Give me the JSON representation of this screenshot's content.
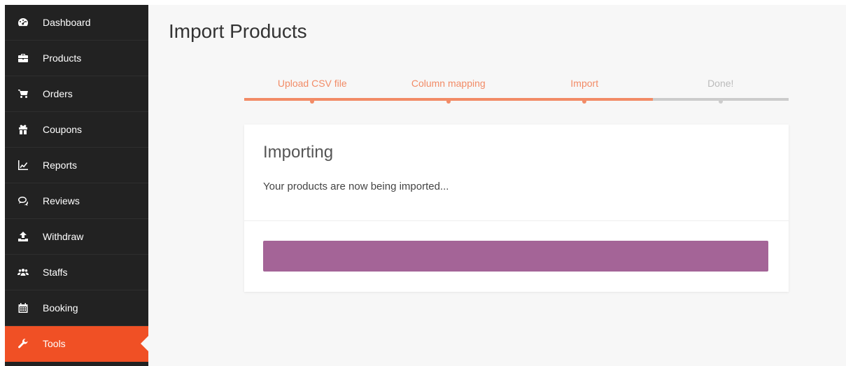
{
  "sidebar": {
    "items": [
      {
        "label": "Dashboard",
        "icon": "dashboard-icon"
      },
      {
        "label": "Products",
        "icon": "briefcase-icon"
      },
      {
        "label": "Orders",
        "icon": "cart-icon"
      },
      {
        "label": "Coupons",
        "icon": "gift-icon"
      },
      {
        "label": "Reports",
        "icon": "line-chart-icon"
      },
      {
        "label": "Reviews",
        "icon": "comments-icon"
      },
      {
        "label": "Withdraw",
        "icon": "upload-icon"
      },
      {
        "label": "Staffs",
        "icon": "users-icon"
      },
      {
        "label": "Booking",
        "icon": "calendar-icon"
      },
      {
        "label": "Tools",
        "icon": "wrench-icon",
        "active": true
      }
    ]
  },
  "page": {
    "title": "Import Products"
  },
  "steps": [
    {
      "label": "Upload CSV file",
      "state": "done"
    },
    {
      "label": "Column mapping",
      "state": "done"
    },
    {
      "label": "Import",
      "state": "active"
    },
    {
      "label": "Done!",
      "state": "todo"
    }
  ],
  "card": {
    "title": "Importing",
    "text": "Your products are now being imported..."
  },
  "progress": {
    "value_percent": 100
  },
  "colors": {
    "sidebar_bg": "#222222",
    "active_accent": "#f05025",
    "step_accent": "#f28b66",
    "step_todo": "#cccccc",
    "progress_fill": "#a46497"
  }
}
